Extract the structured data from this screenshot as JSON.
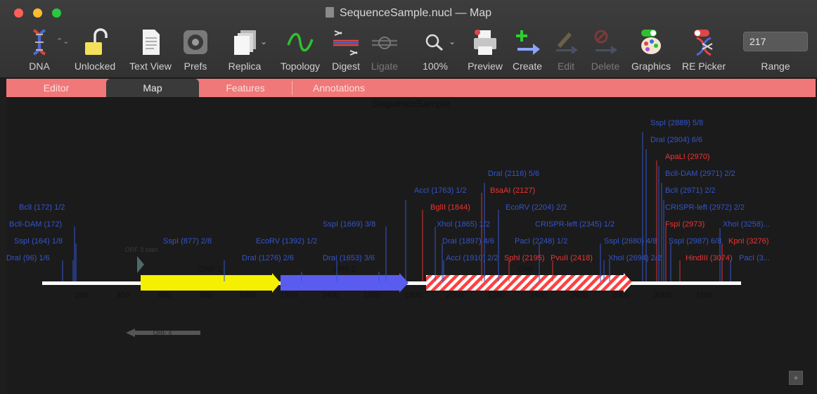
{
  "window": {
    "title": "SequenceSample.nucl — Map"
  },
  "toolbar": {
    "dna": "DNA",
    "unlocked": "Unlocked",
    "textview": "Text View",
    "prefs": "Prefs",
    "replica": "Replica",
    "topology": "Topology",
    "digest": "Digest",
    "ligate": "Ligate",
    "zoom": "100%",
    "preview": "Preview",
    "create": "Create",
    "edit": "Edit",
    "delete": "Delete",
    "graphics": "Graphics",
    "repicker": "RE Picker",
    "range_label": "Range",
    "range_value": "217"
  },
  "tabs": [
    "Editor",
    "Map",
    "Features",
    "Annotations"
  ],
  "map": {
    "sequence_name": "SequenceSample",
    "axis_ticks": [
      "200",
      "400",
      "600",
      "800",
      "1000",
      "1200",
      "1400",
      "1600",
      "1800",
      "2000",
      "2200",
      "2400",
      "2600",
      "2800",
      "3000",
      "3200"
    ],
    "features": [
      {
        "label": "ORF 1",
        "color": "#f5f000",
        "style": "solid"
      },
      {
        "label": "ORF 2",
        "color": "#5a5cf0",
        "style": "solid"
      },
      {
        "label": "ORF 3",
        "color": "#ff4040",
        "style": "hatched"
      }
    ],
    "small_feature": "ORF 3 start",
    "gray_arrow": "ORF 4",
    "sites_blue": [
      "BclI (172) 1/2",
      "BclI-DAM (172)",
      "SspI (164) 1/8",
      "DraI (96) 1/6",
      "SspI (877) 2/8",
      "EcoRV (1392) 1/2",
      "DraI (1276) 2/6",
      "DraI (1653) 3/6",
      "SspI (1669) 3/8",
      "AccI (1763) 1/2",
      "DraI (2116) 5/6",
      "EcoRV (2204) 2/2",
      "XhoI (1865) 1/2",
      "DraI (1897) 4/6",
      "AccI (1910) 2/2",
      "PacI (2248) 1/2",
      "CRISPR-left (2345) 1/2",
      "SspI (2680) 4/8",
      "XhoI (2694) 2/2",
      "SspI (2889) 5/8",
      "DraI (2904) 6/6",
      "BclI-DAM (2971) 2/2",
      "BclI (2971) 2/2",
      "CRISPR-left (2972) 2/2",
      "SspI (2987) 6/8",
      "XhoI (3258)...",
      "PacI (3..."
    ],
    "sites_red": [
      "BglII (1844)",
      "BsaAI (2127)",
      "SphI (2195)",
      "PvuII (2418)",
      "ApaLI (2970)",
      "FspI (2973)",
      "KpnI (3276)",
      "HindIII (3074)"
    ]
  }
}
